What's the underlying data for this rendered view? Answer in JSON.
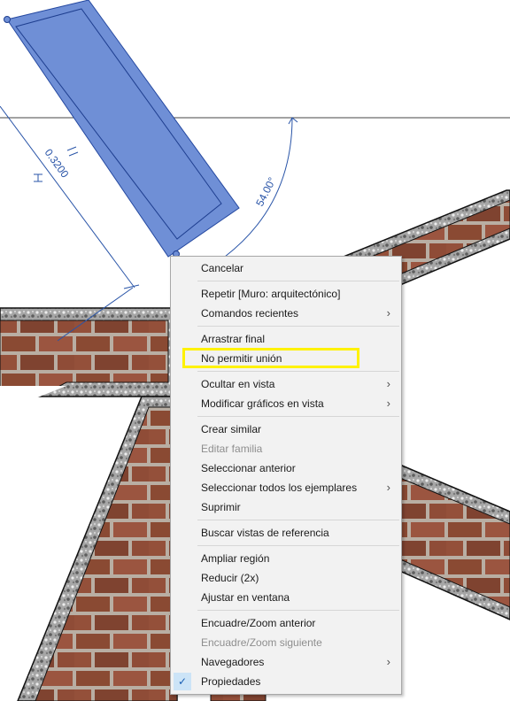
{
  "canvas": {
    "dimension_length": "0.3200",
    "dimension_angle": "54.00°",
    "colors": {
      "wall_fill": "#6f8fd6",
      "dimension_line": "#2a55a8",
      "brick": "#8a4a33",
      "mortar": "#b9aea3",
      "stone": "#9a9a9a"
    }
  },
  "context_menu": {
    "items": [
      {
        "label": "Cancelar"
      },
      {
        "separator": true
      },
      {
        "label": "Repetir [Muro: arquitectónico]"
      },
      {
        "label": "Comandos recientes",
        "submenu": true
      },
      {
        "separator": true
      },
      {
        "label": "Arrastrar final"
      },
      {
        "label": "No permitir unión",
        "highlighted": true
      },
      {
        "separator": true
      },
      {
        "label": "Ocultar en vista",
        "submenu": true
      },
      {
        "label": "Modificar gráficos en vista",
        "submenu": true
      },
      {
        "separator": true
      },
      {
        "label": "Crear similar"
      },
      {
        "label": "Editar familia",
        "disabled": true
      },
      {
        "label": "Seleccionar anterior"
      },
      {
        "label": "Seleccionar todos los ejemplares",
        "submenu": true
      },
      {
        "label": "Suprimir"
      },
      {
        "separator": true
      },
      {
        "label": "Buscar vistas de referencia"
      },
      {
        "separator": true
      },
      {
        "label": "Ampliar región"
      },
      {
        "label": "Reducir (2x)"
      },
      {
        "label": "Ajustar en ventana"
      },
      {
        "separator": true
      },
      {
        "label": "Encuadre/Zoom anterior"
      },
      {
        "label": "Encuadre/Zoom siguiente",
        "disabled": true
      },
      {
        "label": "Navegadores",
        "submenu": true
      },
      {
        "label": "Propiedades",
        "checked": true
      }
    ],
    "submenu_glyph": "›",
    "check_glyph": "✓"
  }
}
